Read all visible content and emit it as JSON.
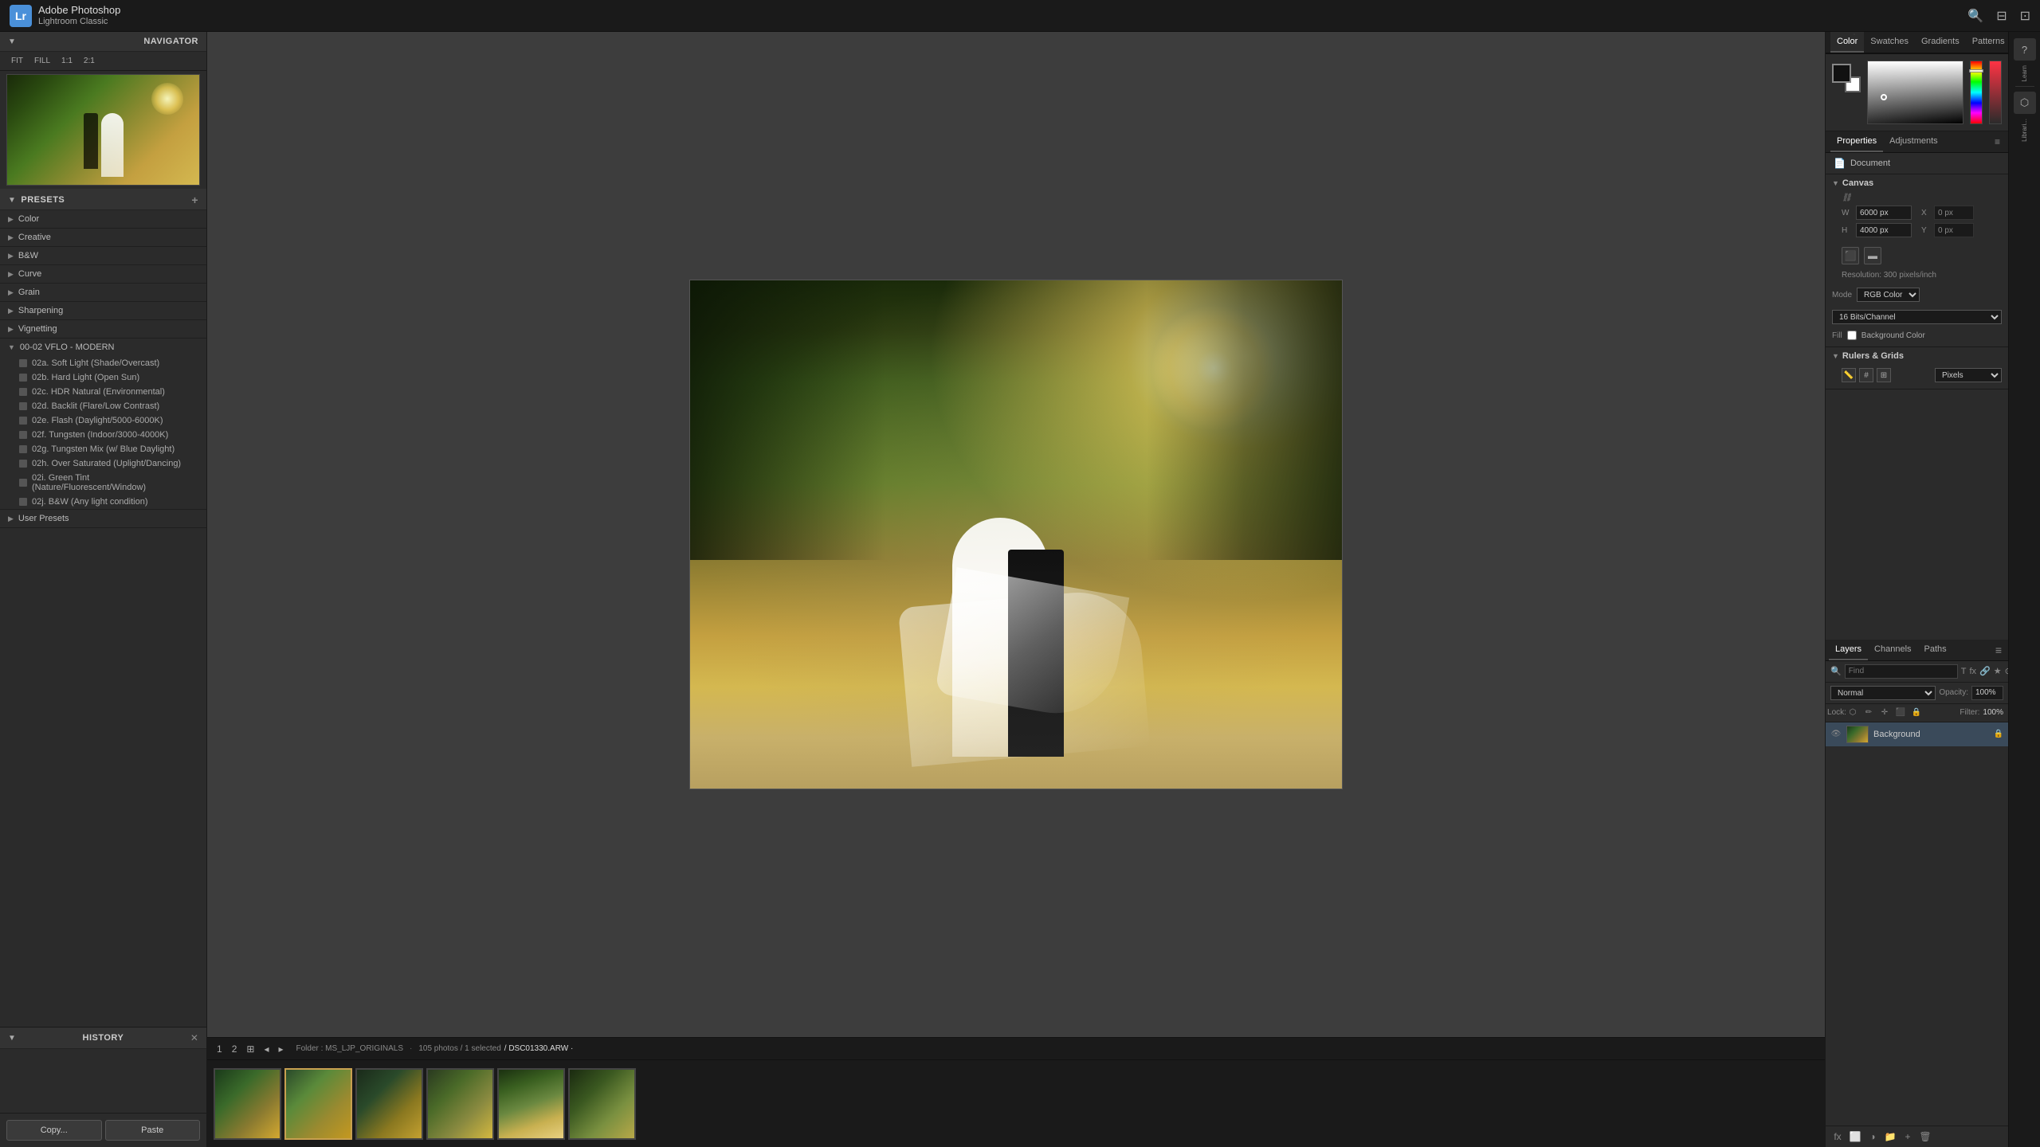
{
  "app": {
    "logo": "Lr",
    "title": "Adobe Photoshop",
    "subtitle": "Lightroom Classic"
  },
  "top_bar": {
    "icons": [
      "search",
      "window",
      "maximize"
    ]
  },
  "navigator": {
    "title": "Navigator",
    "controls": [
      "FIT",
      "FILL",
      "1:1",
      "2:1"
    ]
  },
  "presets": {
    "title": "Presets",
    "add_label": "+",
    "groups": [
      {
        "name": "Color",
        "arrow": "▶",
        "expanded": false
      },
      {
        "name": "Creative",
        "arrow": "▶",
        "expanded": false
      },
      {
        "name": "B&W",
        "arrow": "▶",
        "expanded": false
      },
      {
        "name": "Curve",
        "arrow": "▶",
        "expanded": false
      },
      {
        "name": "Grain",
        "arrow": "▶",
        "expanded": false
      },
      {
        "name": "Sharpening",
        "arrow": "▶",
        "expanded": false
      },
      {
        "name": "Vignetting",
        "arrow": "▶",
        "expanded": false
      }
    ],
    "custom_group": {
      "name": "00-02 VFLO - MODERN",
      "arrow": "▼",
      "expanded": true,
      "items": [
        "02a. Soft Light (Shade/Overcast)",
        "02b. Hard Light (Open Sun)",
        "02c. HDR Natural (Environmental)",
        "02d. Backlit (Flare/Low Contrast)",
        "02e. Flash (Daylight/5000-6000K)",
        "02f. Tungsten (Indoor/3000-4000K)",
        "02g. Tungsten Mix (w/ Blue Daylight)",
        "02h. Over Saturated (Uplight/Dancing)",
        "02i. Green Tint (Nature/Fluorescent/Window)",
        "02j. B&W (Any light condition)"
      ]
    },
    "user_presets": "User Presets"
  },
  "history": {
    "title": "History",
    "close_icon": "✕"
  },
  "buttons": {
    "copy": "Copy...",
    "paste": "Paste"
  },
  "status_bar": {
    "view_icons": [
      "1",
      "2",
      "grid",
      "left",
      "right"
    ],
    "folder_label": "Folder : MS_LJP_ORIGINALS",
    "photo_count": "105 photos / 1 selected",
    "filename": "/ DSC01330.ARW ·"
  },
  "ps_right": {
    "top_tabs": [
      "Color",
      "Swatches",
      "Gradients",
      "Patterns"
    ],
    "learn_label": "Learn",
    "libraries_label": "Librari...",
    "color_spectrum_label": "Color",
    "swatches_label": "Swatches"
  },
  "properties": {
    "tabs": [
      "Properties",
      "Adjustments"
    ],
    "document_btn": "Document",
    "canvas_section": "Canvas",
    "width_label": "W",
    "width_val": "6000 px",
    "height_label": "H",
    "height_val": "4000 px",
    "x_label": "X",
    "x_val": "0 px",
    "y_label": "Y",
    "y_val": "0 px",
    "resolution_label": "Resolution: 300 pixels/inch",
    "mode_label": "Mode",
    "mode_val": "RGB Color",
    "bits_val": "16 Bits/Channel",
    "fill_label": "Fill",
    "bg_color_label": "Background Color"
  },
  "rulers_grids": {
    "title": "Rulers & Grids",
    "unit": "Pixels"
  },
  "layers": {
    "tabs": [
      "Layers",
      "Channels",
      "Paths"
    ],
    "search_placeholder": "Find",
    "blend_mode": "Normal",
    "opacity_label": "Opacity:",
    "opacity_val": "100%",
    "filter_label": "Filter:",
    "filter_val": "100%",
    "lock_label": "Lock:",
    "items": [
      {
        "name": "Background",
        "visible": true,
        "locked": true
      }
    ]
  }
}
